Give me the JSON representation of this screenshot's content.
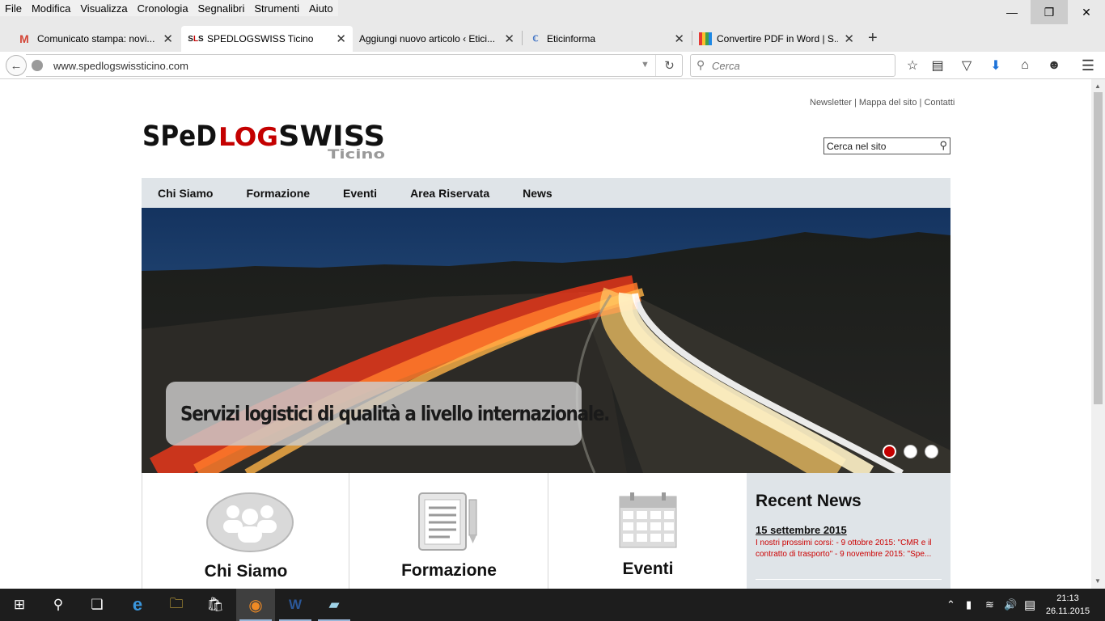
{
  "menubar": {
    "items": [
      "File",
      "Modifica",
      "Visualizza",
      "Cronologia",
      "Segnalibri",
      "Strumenti",
      "Aiuto"
    ],
    "underline_letters": [
      "F",
      "M",
      "V",
      "C",
      "S",
      "S",
      "A"
    ]
  },
  "tabs": [
    {
      "label": "Comunicato stampa: novi...",
      "icon": "gmail-icon"
    },
    {
      "label": "SPEDLOGSWISS Ticino",
      "icon": "sls-icon"
    },
    {
      "label": "Aggiungi nuovo articolo ‹ Etici...",
      "icon": "none"
    },
    {
      "label": "Eticinforma",
      "icon": "eticinforma-icon"
    },
    {
      "label": "Convertire PDF in Word | S...",
      "icon": "grid-icon"
    }
  ],
  "navbar": {
    "url": "www.spedlogswissticino.com",
    "search_placeholder": "Cerca"
  },
  "site": {
    "top_links": "Newsletter | Mappa del sito | Contatti",
    "search_placeholder": "Cerca nel sito",
    "logo": {
      "spedlog_main": "SPeD",
      "log": "LOG",
      "swiss": "SWISS",
      "ticino": "Ticino"
    },
    "nav": [
      "Chi Siamo",
      "Formazione",
      "Eventi",
      "Area Riservata",
      "News"
    ],
    "hero_caption": "Servizi logistici di qualità a livello internazionale.",
    "slider_dots": 3,
    "boxes": [
      {
        "title": "Chi Siamo",
        "icon": "people-icon"
      },
      {
        "title": "Formazione",
        "icon": "notepad-icon"
      },
      {
        "title": "Eventi",
        "icon": "calendar-icon"
      }
    ],
    "news": {
      "heading": "Recent News",
      "date": "15 settembre 2015",
      "text": "I nostri prossimi corsi: - 9 ottobre 2015: \"CMR e il contratto di trasporto\" - 9 novembre 2015: \"Spe..."
    }
  },
  "taskbar": {
    "time": "21:13",
    "date": "26.11.2015"
  },
  "colors": {
    "accent_red": "#c40000",
    "nav_bg": "#dfe4e8",
    "news_link": "#cc0000"
  }
}
